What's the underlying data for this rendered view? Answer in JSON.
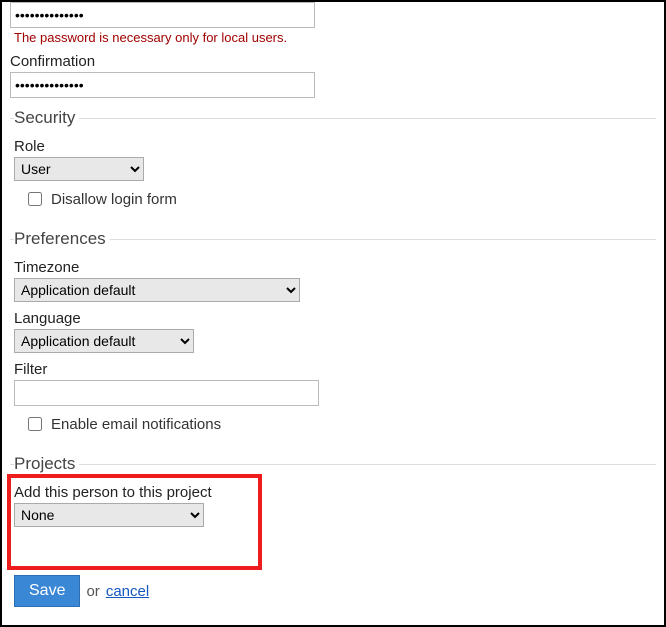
{
  "password": {
    "value": "••••••••••••••",
    "hint": "The password is necessary only for local users.",
    "confirmation_label": "Confirmation",
    "confirmation_value": "••••••••••••••"
  },
  "security": {
    "legend": "Security",
    "role_label": "Role",
    "role_value": "User",
    "disallow_label": "Disallow login form"
  },
  "preferences": {
    "legend": "Preferences",
    "timezone_label": "Timezone",
    "timezone_value": "Application default",
    "language_label": "Language",
    "language_value": "Application default",
    "filter_label": "Filter",
    "filter_value": "",
    "email_label": "Enable email notifications"
  },
  "projects": {
    "legend": "Projects",
    "add_label": "Add this person to this project",
    "project_value": "None"
  },
  "actions": {
    "save": "Save",
    "or": "or",
    "cancel": "cancel"
  }
}
